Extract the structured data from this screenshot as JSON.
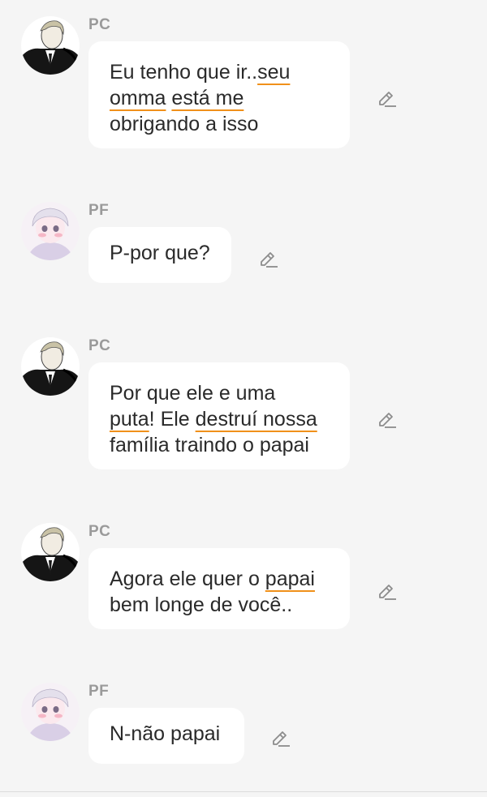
{
  "messages": [
    {
      "sender": "PC",
      "avatar": "pc-avatar",
      "lines": [
        [
          {
            "t": "Eu tenho que ir.."
          },
          {
            "t": "seu",
            "u": true
          }
        ],
        [
          {
            "t": "omma",
            "u": true
          },
          {
            "t": " "
          },
          {
            "t": "está me",
            "u": true
          }
        ],
        [
          {
            "t": "obrigando a isso"
          }
        ]
      ]
    },
    {
      "sender": "PF",
      "avatar": "pf-avatar",
      "lines": [
        [
          {
            "t": "P-por que?"
          }
        ]
      ]
    },
    {
      "sender": "PC",
      "avatar": "pc-avatar",
      "lines": [
        [
          {
            "t": "Por que ele e uma"
          }
        ],
        [
          {
            "t": "puta",
            "u": true
          },
          {
            "t": "! Ele "
          },
          {
            "t": "destruí nossa",
            "u": true
          }
        ],
        [
          {
            "t": "família traindo o papai"
          }
        ]
      ]
    },
    {
      "sender": "PC",
      "avatar": "pc-avatar",
      "lines": [
        [
          {
            "t": "Agora ele quer o "
          },
          {
            "t": "papai",
            "u": true
          }
        ],
        [
          {
            "t": "bem longe de você.."
          }
        ]
      ]
    },
    {
      "sender": "PF",
      "avatar": "pf-avatar",
      "lines": [
        [
          {
            "t": "N-não papai"
          }
        ]
      ]
    }
  ],
  "icons": {
    "edit": "pencil-icon"
  },
  "colors": {
    "background": "#f5f5f5",
    "bubble": "#ffffff",
    "sender": "#9a9a9a",
    "text": "#2a2a2a",
    "underline": "#f0901a",
    "icon": "#8c8c8c"
  }
}
